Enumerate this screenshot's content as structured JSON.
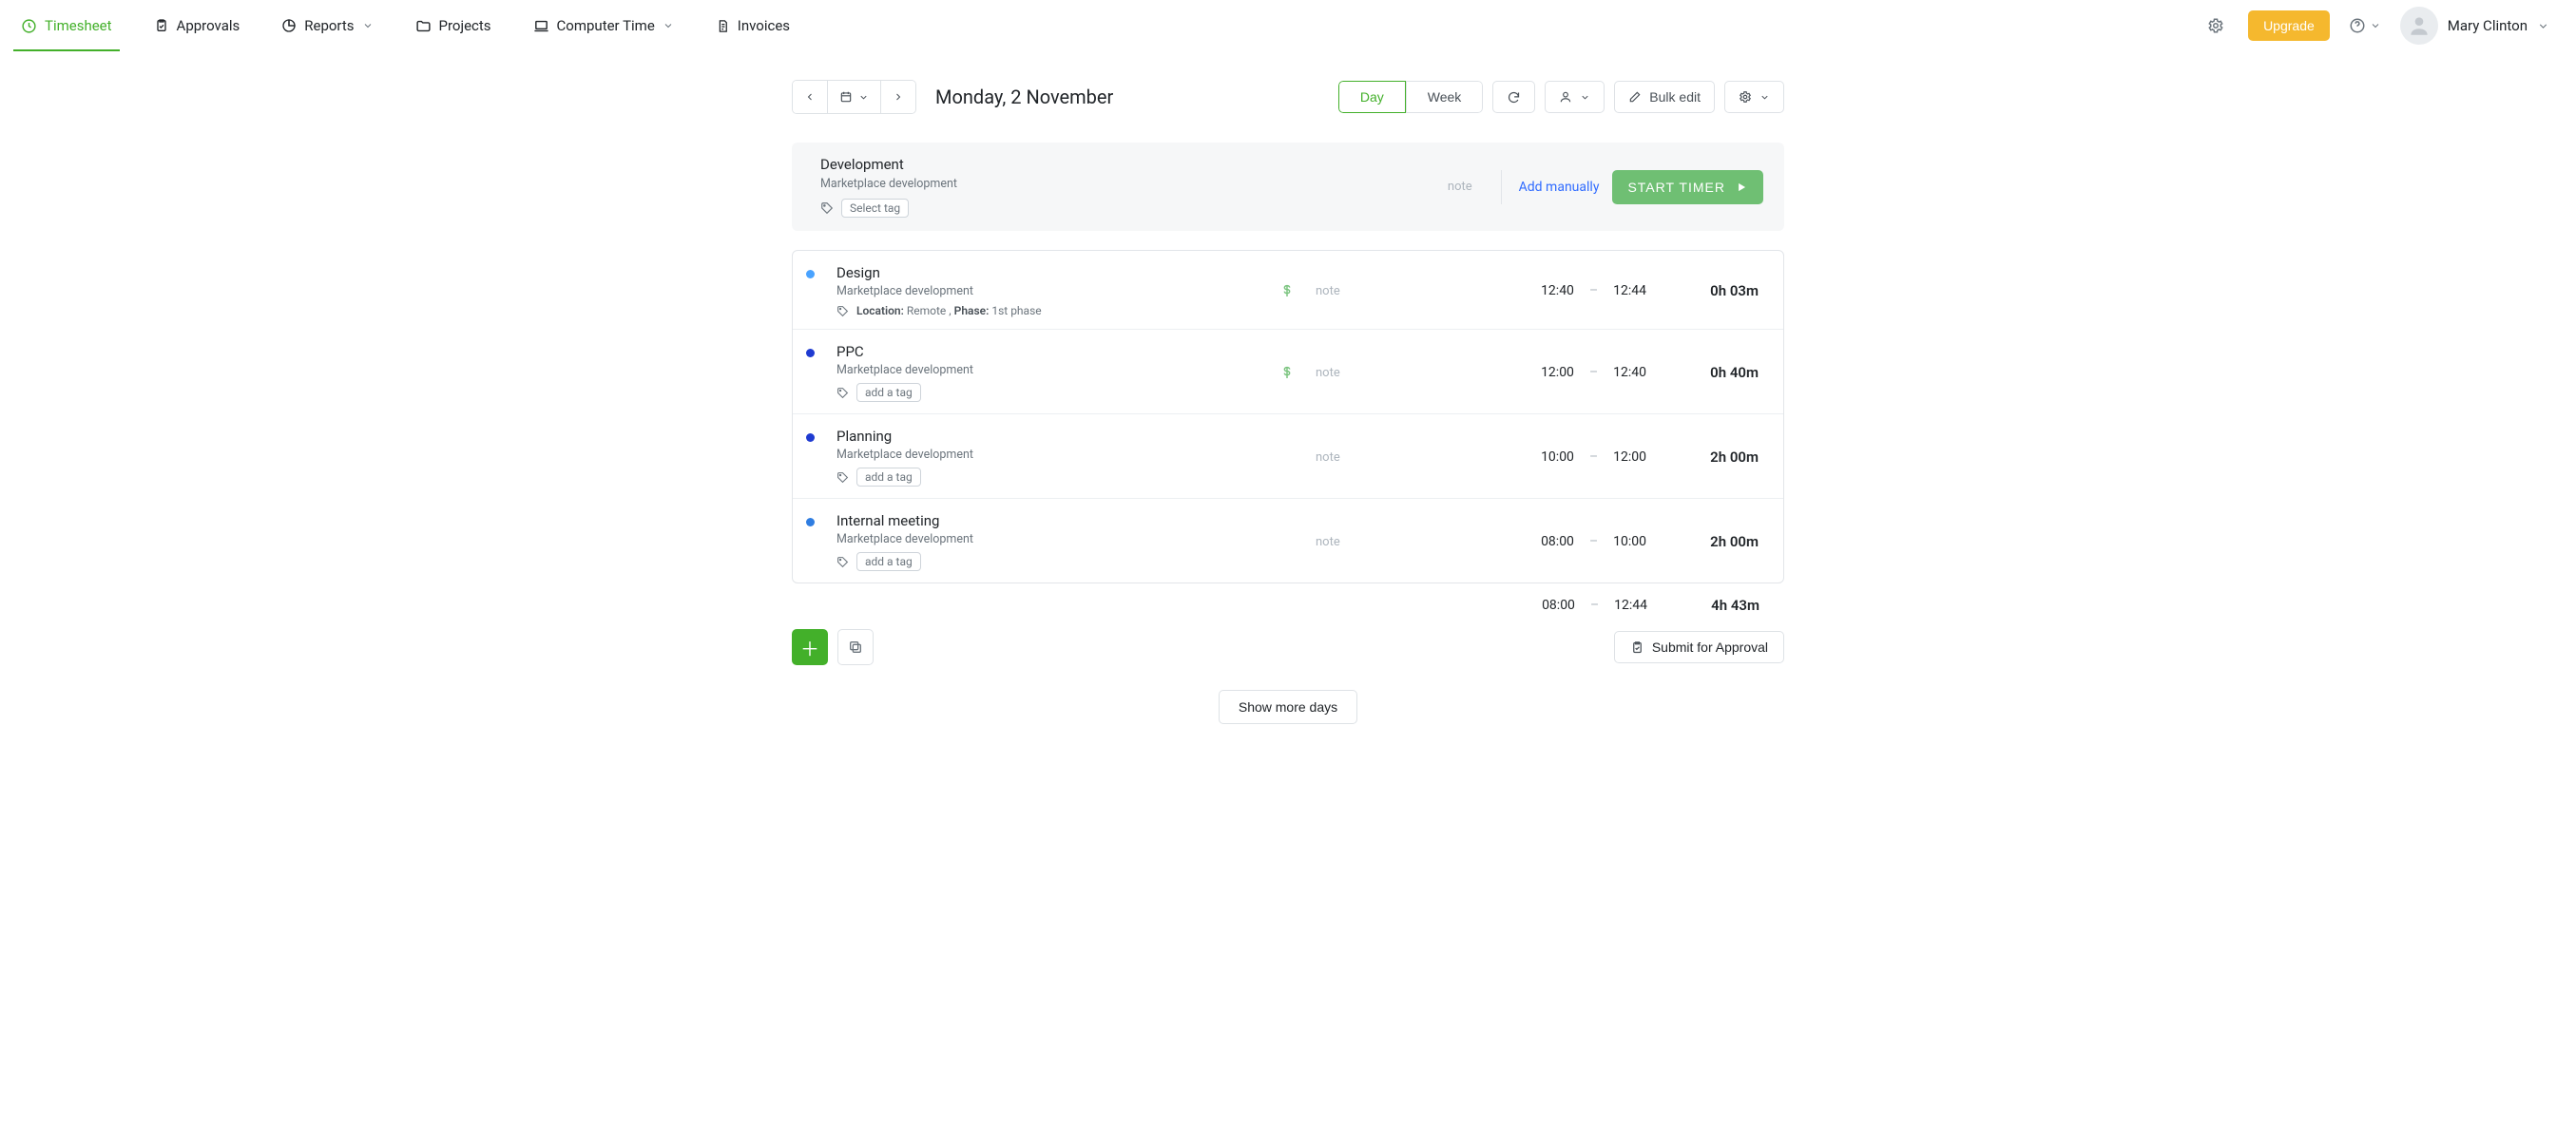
{
  "nav": {
    "items": [
      {
        "label": "Timesheet"
      },
      {
        "label": "Approvals"
      },
      {
        "label": "Reports"
      },
      {
        "label": "Projects"
      },
      {
        "label": "Computer Time"
      },
      {
        "label": "Invoices"
      }
    ],
    "upgrade_label": "Upgrade",
    "user_name": "Mary Clinton"
  },
  "date_toolbar": {
    "title": "Monday, 2 November",
    "view_day": "Day",
    "view_week": "Week",
    "bulk_edit": "Bulk edit"
  },
  "composer": {
    "title": "Development",
    "project": "Marketplace development",
    "select_tag": "Select tag",
    "note_placeholder": "note",
    "add_manually": "Add manually",
    "start_timer": "START TIMER"
  },
  "entries": [
    {
      "dot": "blue-light",
      "title": "Design",
      "project": "Marketplace development",
      "tags_raw": "Location: Remote , Phase: 1st phase",
      "tag_labels": [
        {
          "k": "Location",
          "v": "Remote"
        },
        {
          "k": "Phase",
          "v": "1st phase"
        }
      ],
      "billable": true,
      "note": "note",
      "start": "12:40",
      "end": "12:44",
      "duration": "0h 03m",
      "add_tag_chip": false
    },
    {
      "dot": "blue-dark",
      "title": "PPC",
      "project": "Marketplace development",
      "tag_labels": [],
      "billable": true,
      "note": "note",
      "start": "12:00",
      "end": "12:40",
      "duration": "0h 40m",
      "add_tag_chip": true,
      "add_tag_label": "add a tag"
    },
    {
      "dot": "blue-dark",
      "title": "Planning",
      "project": "Marketplace development",
      "tag_labels": [],
      "billable": false,
      "note": "note",
      "start": "10:00",
      "end": "12:00",
      "duration": "2h 00m",
      "add_tag_chip": true,
      "add_tag_label": "add a tag"
    },
    {
      "dot": "blue-mid",
      "title": "Internal meeting",
      "project": "Marketplace development",
      "tag_labels": [],
      "billable": false,
      "note": "note",
      "start": "08:00",
      "end": "10:00",
      "duration": "2h 00m",
      "add_tag_chip": true,
      "add_tag_label": "add a tag"
    }
  ],
  "totals": {
    "start": "08:00",
    "end": "12:44",
    "duration": "4h 43m"
  },
  "buttons": {
    "submit": "Submit for Approval",
    "show_more": "Show more days"
  },
  "colors": {
    "green": "#43b02a",
    "green_light": "#6fbf73",
    "orange": "#f5b82e",
    "link_blue": "#2f6bff"
  }
}
